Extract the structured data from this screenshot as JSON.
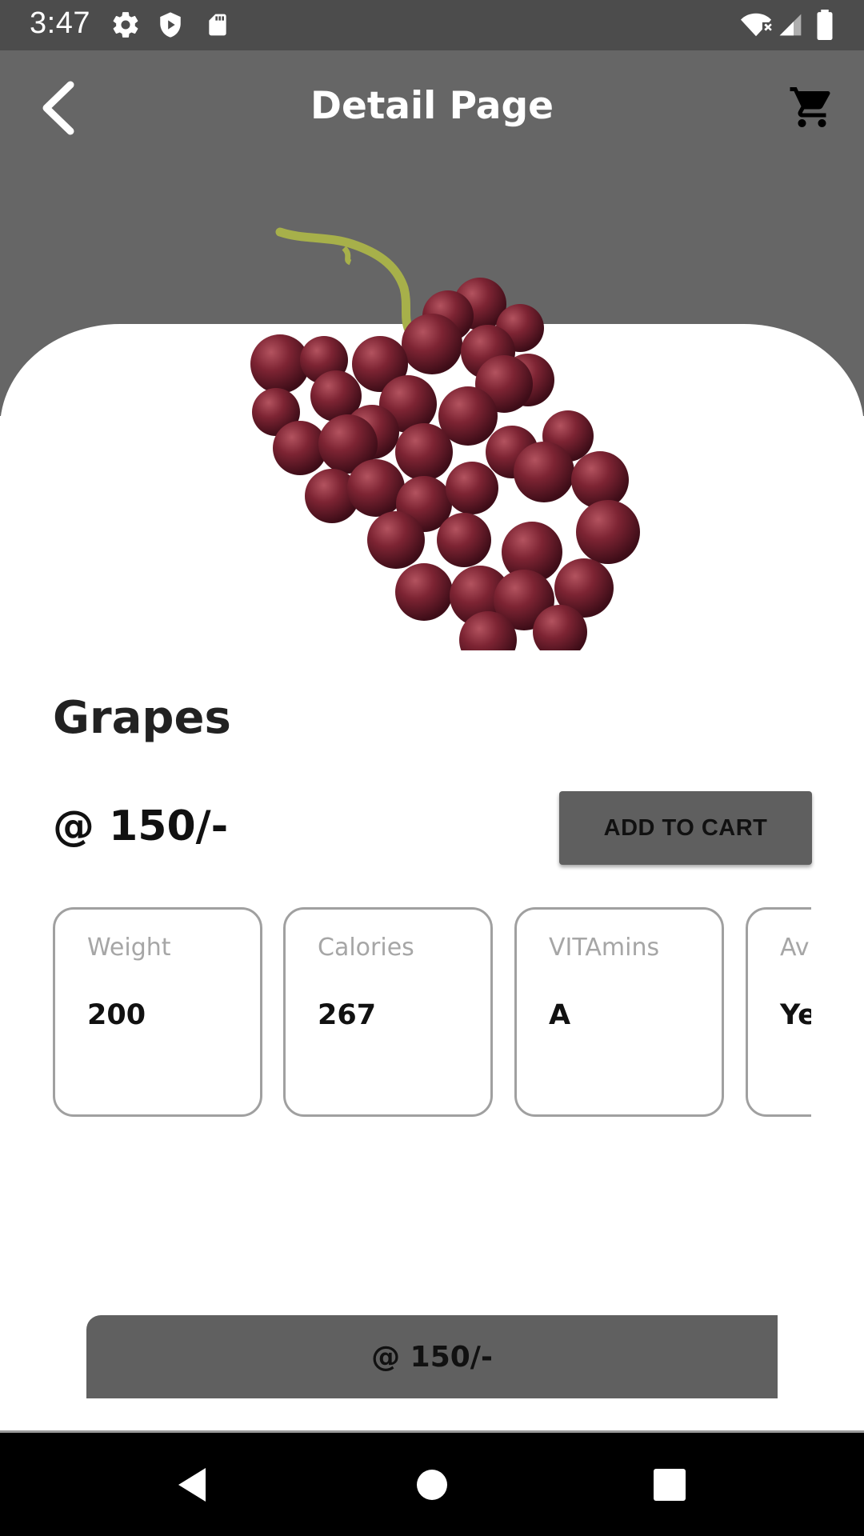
{
  "status_bar": {
    "time": "3:47",
    "left_icons": [
      "settings-icon",
      "shield-play-icon",
      "sd-card-icon"
    ],
    "right_icons": [
      "wifi-off-icon",
      "cell-signal-icon",
      "battery-icon"
    ]
  },
  "app_bar": {
    "title": "Detail Page",
    "back_icon": "back-arrow-icon",
    "cart_icon": "shopping-cart-icon"
  },
  "product": {
    "image": "grapes-image",
    "name": "Grapes",
    "price": "@ 150/-",
    "add_to_cart_label": "ADD TO CART"
  },
  "info_cards": [
    {
      "label": "Weight",
      "value": "200"
    },
    {
      "label": "Calories",
      "value": "267"
    },
    {
      "label": "VITAmins",
      "value": "A"
    },
    {
      "label": "Av",
      "value": "Ye"
    }
  ],
  "bottom_bar": {
    "price": "@ 150/-"
  },
  "colors": {
    "status_bar": "#4c4c4c",
    "header": "#666666",
    "button": "#5f5f5f",
    "card_border": "#a0a0a0",
    "label": "#a6a6a6"
  },
  "nav": [
    "nav-back-icon",
    "nav-home-icon",
    "nav-recents-icon"
  ]
}
